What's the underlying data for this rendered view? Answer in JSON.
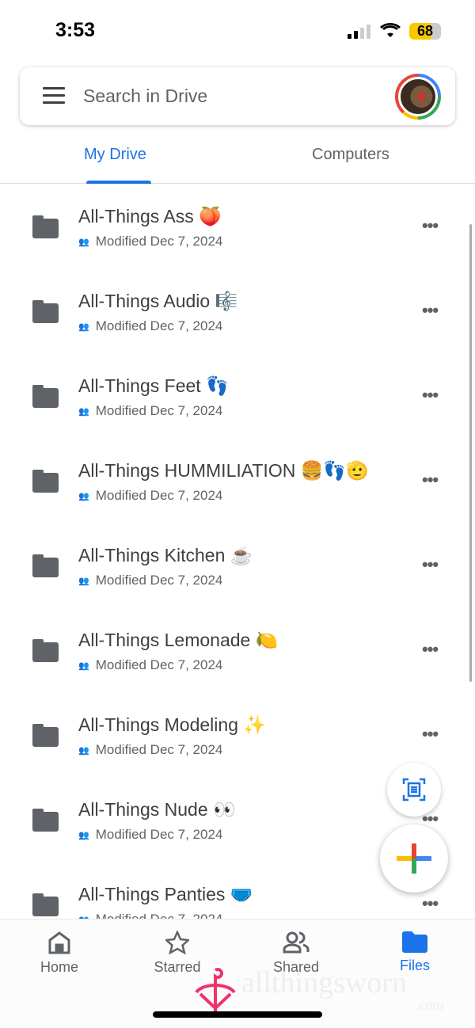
{
  "status_bar": {
    "time": "3:53",
    "battery": "68"
  },
  "search": {
    "placeholder": "Search in Drive"
  },
  "tabs": [
    {
      "label": "My Drive",
      "active": true
    },
    {
      "label": "Computers",
      "active": false
    }
  ],
  "files": [
    {
      "name": "All-Things Ass 🍑",
      "modified": "Modified Dec 7, 2024"
    },
    {
      "name": "All-Things Audio 🎼",
      "modified": "Modified Dec 7, 2024"
    },
    {
      "name": "All-Things Feet 👣",
      "modified": "Modified Dec 7, 2024"
    },
    {
      "name": "All-Things HUMMILIATION 🍔👣🫡",
      "modified": "Modified Dec 7, 2024"
    },
    {
      "name": "All-Things Kitchen ☕️",
      "modified": "Modified Dec 7, 2024"
    },
    {
      "name": "All-Things Lemonade 🍋",
      "modified": "Modified Dec 7, 2024"
    },
    {
      "name": "All-Things Modeling ✨",
      "modified": "Modified Dec 7, 2024"
    },
    {
      "name": "All-Things Nude 👀",
      "modified": "Modified Dec 7, 2024"
    },
    {
      "name": "All-Things Panties 🩲",
      "modified": "Modified Dec 7, 2024"
    }
  ],
  "nav": [
    {
      "label": "Home",
      "icon": "home-icon"
    },
    {
      "label": "Starred",
      "icon": "star-icon"
    },
    {
      "label": "Shared",
      "icon": "people-icon"
    },
    {
      "label": "Files",
      "icon": "folder-icon",
      "active": true
    }
  ],
  "watermark": "allthingsworn.com",
  "colors": {
    "accent": "#1a73e8",
    "text": "#3c4043",
    "secondary": "#5f6368"
  }
}
